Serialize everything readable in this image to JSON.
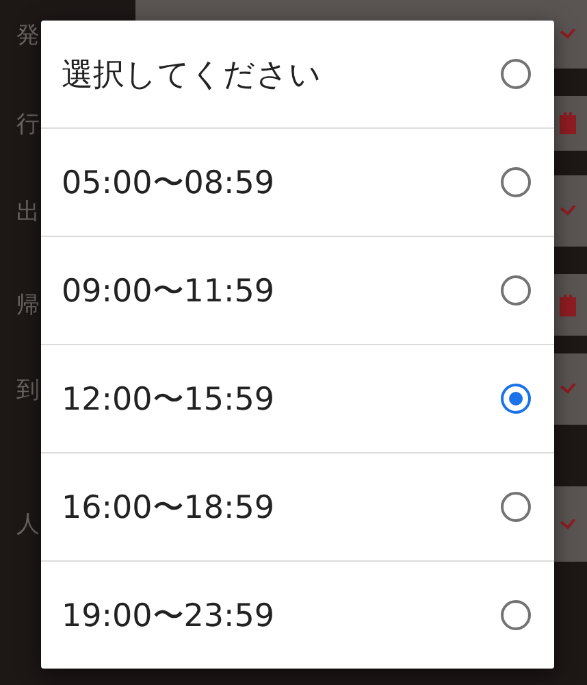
{
  "background_form": {
    "rows": [
      {
        "label": "発",
        "kind": "select"
      },
      {
        "label": "行",
        "kind": "date"
      },
      {
        "label": "出",
        "kind": "select"
      },
      {
        "label": "帰",
        "kind": "date"
      },
      {
        "label": "到",
        "kind": "select"
      },
      {
        "label": "人",
        "kind": "select"
      }
    ]
  },
  "dialog": {
    "options": [
      {
        "label": "選択してください",
        "selected": false
      },
      {
        "label": "05:00〜08:59",
        "selected": false
      },
      {
        "label": "09:00〜11:59",
        "selected": false
      },
      {
        "label": "12:00〜15:59",
        "selected": true
      },
      {
        "label": "16:00〜18:59",
        "selected": false
      },
      {
        "label": "19:00〜23:59",
        "selected": false
      }
    ]
  }
}
